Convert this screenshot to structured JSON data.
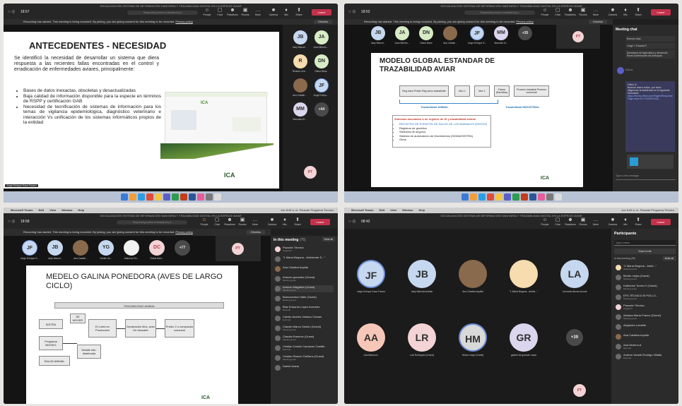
{
  "window_title": "SOCIALIZACIÓN SISTEMA DE INFORMACIÓN SANITARIA Y TRAZABILIDAD DIGITAL EN LA ESPECIE AVIAR",
  "window_title_2": "SOCIALIZACIÓN SISTEMA DE INFORMACIÓN SANITARIA Y TRAZABILIDAD DIGITAL EN LA ESPECIE AVIAR",
  "mac_menu": [
    "Microsoft Teams",
    "Edit",
    "View",
    "Window",
    "Help"
  ],
  "mac_status": "Jue 8:45 a. m.   Pausote Programa Técnico",
  "recording_text": "Recording has started. This meeting is being recorded. By joining, you are giving consent for this meeting to be recorded.",
  "privacy_link": "Privacy policy",
  "dismiss": "Dismiss",
  "toolbar": {
    "people": "People",
    "chat": "Chat",
    "reactions": "Reactions",
    "rooms": "Rooms",
    "more": "More",
    "camera": "Camera",
    "mic": "Mic",
    "share": "Share",
    "leave": "Leave"
  },
  "search_hint": "Requesting control is disabled by a",
  "q1": {
    "time": "18:57",
    "slide_title": "ANTECEDENTES - NECESIDAD",
    "intro": "Se identificó la necesidad de desarrollar un sistema que diera respuesta a las recientes fallas encontradas en el control y erradicación de enfermedades aviares, principalmente:",
    "bullets": [
      "Bases de datos inexactas, obsoletas y desactualizadas",
      "Baja calidad de información disponible para la especie en términos de RSPP y certificación GAB",
      "Necesidad de tecnificación de sistemas de información para los temas de vigilancia epidemiológica, diagnóstico veterinario e interacción Vs unificación de los sistemas informáticos propios de la entidad"
    ],
    "presenter": "Jorge Enrique Sosa Franco",
    "logo": "ICA",
    "participants": [
      {
        "initials": "JB",
        "name": "Jady Marcel...",
        "color": "#c6d8f0"
      },
      {
        "initials": "JA",
        "name": "Juan Alberto...",
        "color": "#d7ecc5"
      },
      {
        "initials": "R",
        "name": "Ricardo Ura...",
        "color": "#f6dcae"
      },
      {
        "initials": "DN",
        "name": "Diana Nieto",
        "color": "#d7ecc5"
      },
      {
        "initials": "",
        "name": "Ana Catalin...",
        "color": "#8a6a4c"
      },
      {
        "initials": "JF",
        "name": "Jorge Enriqu...",
        "color": "#c6d8f0"
      },
      {
        "initials": "MM",
        "name": "Manuela M...",
        "color": "#dcd5ee"
      },
      {
        "initials": "+44",
        "name": "",
        "color": "#4a4a4a"
      }
    ],
    "pt": "PT"
  },
  "q2": {
    "time": "18:52",
    "slide_title": "MODELO GLOBAL ESTANDAR DE TRAZABILIDAD AVIAR",
    "flow": [
      "Reg único Predio Reg único animal/lote",
      "Mov 1",
      "Mov 1",
      "Faena (Sacrificio)",
      "Proceso industrial Proceso comercial"
    ],
    "traz_animal": "Trazabilidad ANIMAL",
    "traz_industrial": "Trazabilidad INDUSTRIAL",
    "sistemas_title": "Sistemas asociados a un registro de ID y trazabilidad animal",
    "sistemas": [
      "REGISTRO DE EVENTOS DE SALUD DE LOS ANIMALES (SINTUS)",
      "Registros de genética",
      "Sistemas de seguros",
      "Sistema de autorización de Movimientos (SIGMA/SISTRA)",
      "Otros"
    ],
    "participants": [
      {
        "initials": "JB",
        "name": "Jady Marcel...",
        "color": "#c6d8f0"
      },
      {
        "initials": "JA",
        "name": "Juan Alberto...",
        "color": "#d7ecc5"
      },
      {
        "initials": "DN",
        "name": "Diana Nieto",
        "color": "#d7ecc5"
      },
      {
        "initials": "",
        "name": "Ana Catalin...",
        "color": "#8a6a4c"
      },
      {
        "initials": "JF",
        "name": "Jorge Enrique S...",
        "color": "#c6d8f0"
      },
      {
        "initials": "MM",
        "name": "Manuela M...",
        "color": "#dcd5ee"
      },
      {
        "initials": "+35",
        "name": "",
        "color": "#4a4a4a"
      }
    ],
    "pt": "PT",
    "chat_title": "Meeting chat",
    "chat_msgs": [
      "Buenos días",
      "Jorge I. Posada P.",
      "Secretaría de Agricultura y desarrollo Rural Gobernación de Antioquia",
      "ICA.co",
      "Fabio Jr.",
      "Buenos días a todos, por favor diligenciar la asistencia en el siguiente formulario",
      "https://forms.office.com/Pages/ResponsePage.aspx?id=7DZ6KGVQh..."
    ],
    "chat_input": "Type a new message"
  },
  "q3": {
    "time": "18:58",
    "slide_title": "MEDELO GALINA PONEDORA (AVES DE LARGO CICLO)",
    "banner": "TRAZABILIDAD ANIMAL",
    "boxes": [
      "SISTRA",
      "SE MOVER",
      "El Lotes en Producción",
      "Declaración Mov. aves De descarte",
      "Predio 2 o comprador consume",
      "Programa BIOSEG",
      "Detalle info. distribuida",
      "SALUD ANIMAL"
    ],
    "participants": [
      {
        "initials": "JF",
        "name": "Jorge Enrique S...",
        "color": "#c6d8f0"
      },
      {
        "initials": "JB",
        "name": "Jady Marcel...",
        "color": "#c6d8f0"
      },
      {
        "initials": "",
        "name": "Ana Catalin...",
        "color": "#8a6a4c"
      },
      {
        "initials": "YG",
        "name": "Yamile Go...",
        "color": "#c6d8f0"
      },
      {
        "initials": "",
        "name": "Mauricio Ro...",
        "color": "#f2f2f2"
      },
      {
        "initials": "DC",
        "name": "Diana Mari...",
        "color": "#f3d3d5"
      },
      {
        "initials": "+77",
        "name": "",
        "color": "#4a4a4a"
      }
    ],
    "pt": "PT",
    "panel_title": "In this meeting",
    "panel_count": "(76)",
    "mute_all": "Mute all",
    "people": [
      {
        "name": "Pausote Técnico",
        "role": "Organizer"
      },
      {
        "name": "\"1 María Begona - Ambientar S...\"",
        "role": ""
      },
      {
        "name": "Ana Catalina Aquilla",
        "role": ""
      },
      {
        "name": "Antonio gonzalez (Guest)",
        "role": "Meeting guest"
      },
      {
        "name": "Antonio Magallon (Guest)",
        "role": "Meeting guest"
      },
      {
        "name": "Buenaventud Valle (Guest)",
        "role": "Meeting guest"
      },
      {
        "name": "Blas Eduardo López Acevedo",
        "role": "External"
      },
      {
        "name": "Camilo Andres Velasco Charan",
        "role": "External"
      },
      {
        "name": "Claudio Marco Grisión (Guest)",
        "role": "Meeting guest"
      },
      {
        "name": "Claudia Ramírez (Guest)",
        "role": "Meeting guest"
      },
      {
        "name": "Cristian Camilo Camacho Castillo",
        "role": "External"
      },
      {
        "name": "Cristian Ramon Orellano (Guest)",
        "role": "Meeting guest"
      },
      {
        "name": "Daniel Arana",
        "role": ""
      }
    ]
  },
  "q4": {
    "time": "08:42",
    "tiles": [
      {
        "initials": "JF",
        "name": "Jorge Enrique Sosa Franco",
        "color": "#c6d8f0"
      },
      {
        "initials": "JB",
        "name": "Jady Marcela Arellan",
        "color": "#c6d8f0"
      },
      {
        "initials": "",
        "name": "Ana Catalina Aquilla",
        "color": "#8a6a4c"
      },
      {
        "initials": "",
        "name": "\"1 María Begona - Ambie...\"",
        "color": "#f6dcae"
      },
      {
        "initials": "LA",
        "name": "Leonardo Alonso Acuria",
        "color": "#c6d8f0"
      },
      {
        "initials": "AA",
        "name": "Ana Blanca A.",
        "color": "#f6c7b8"
      },
      {
        "initials": "LR",
        "name": "Luis Rodríguez (Guest)",
        "color": "#f3d3d5"
      },
      {
        "initials": "HM",
        "name": "Héctor mayo (Guest)",
        "color": "#d9d9d9"
      },
      {
        "initials": "GR",
        "name": "gabriel de guzmán rosas",
        "color": "#dcd5ee"
      },
      {
        "initials": "+39",
        "name": "",
        "color": "#4a4a4a"
      }
    ],
    "pt": "PT",
    "panel_title": "Participants",
    "search": "Type a name",
    "share_invite": "Share invite",
    "section": "In this meeting (39)",
    "mute_all": "Mute all",
    "people": [
      {
        "name": "\"1 María Begona - Ambi...\"",
        "role": "Meeting guest"
      },
      {
        "name": "Benito mejía (Guest)",
        "role": "Meeting guest"
      },
      {
        "name": "Katherine Torres H (Guest)",
        "role": "Meeting guest"
      },
      {
        "name": "EFS TÉCNICO M POLLO...",
        "role": "Meeting guest"
      },
      {
        "name": "Pausote Técnico",
        "role": "Organizer"
      },
      {
        "name": "Ashana María Franco (Guest)",
        "role": "Meeting guest"
      },
      {
        "name": "Alejandro Lamelle",
        "role": ""
      },
      {
        "name": "Ana Catalina Aquilla",
        "role": ""
      },
      {
        "name": "Ana Moreno A.",
        "role": "External"
      },
      {
        "name": "Andrea Yaneth Rodrigo Villalta",
        "role": "External"
      }
    ]
  }
}
